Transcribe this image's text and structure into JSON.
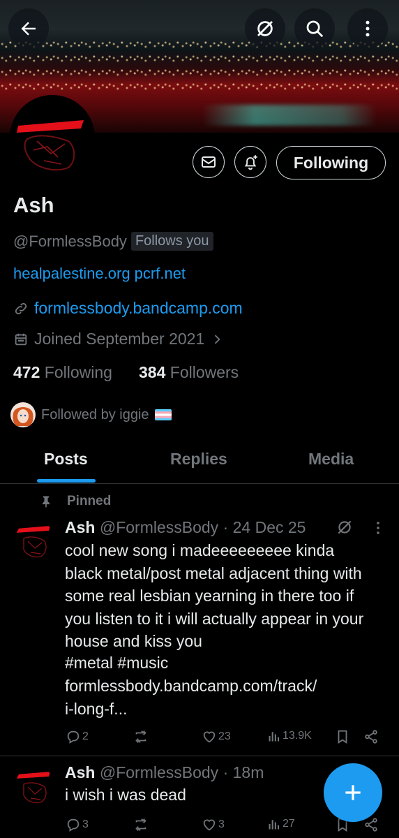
{
  "profile": {
    "name": "Ash",
    "handle": "@FormlessBody",
    "follows_you": "Follows you",
    "bio": "healpalestine.org pcrf.net",
    "website": "formlessbody.bandcamp.com",
    "joined": "Joined September 2021",
    "following_count": "472",
    "following_label": "Following",
    "followers_count": "384",
    "followers_label": "Followers",
    "followed_by": "Followed by iggie"
  },
  "header": {
    "follow_button": "Following"
  },
  "tabs": [
    {
      "label": "Posts",
      "active": true
    },
    {
      "label": "Replies",
      "active": false
    },
    {
      "label": "Media",
      "active": false
    }
  ],
  "posts": [
    {
      "pinned_label": "Pinned",
      "name": "Ash",
      "meta": "@FormlessBody · 24 Dec 25",
      "text": "cool new song i madeeeeeeeee kinda black metal/post metal adjacent thing with some real lesbian yearning in there too if you listen to it i will actually appear in your house and kiss you",
      "hashtags": "#metal #music",
      "link_line1": "formlessbody.bandcamp.com/track/",
      "link_line2": "i-long-f...",
      "replies": "2",
      "reposts": "",
      "likes": "23",
      "views": "13.9K"
    },
    {
      "name": "Ash",
      "meta": "@FormlessBody · 18m",
      "text": "i wish i was dead",
      "replies": "3",
      "reposts": "",
      "likes": "3",
      "views": "27"
    }
  ],
  "colors": {
    "accent": "#1d9bf0",
    "background": "#000000",
    "muted_text": "#71767b",
    "primary_text": "#e7e9ea"
  }
}
